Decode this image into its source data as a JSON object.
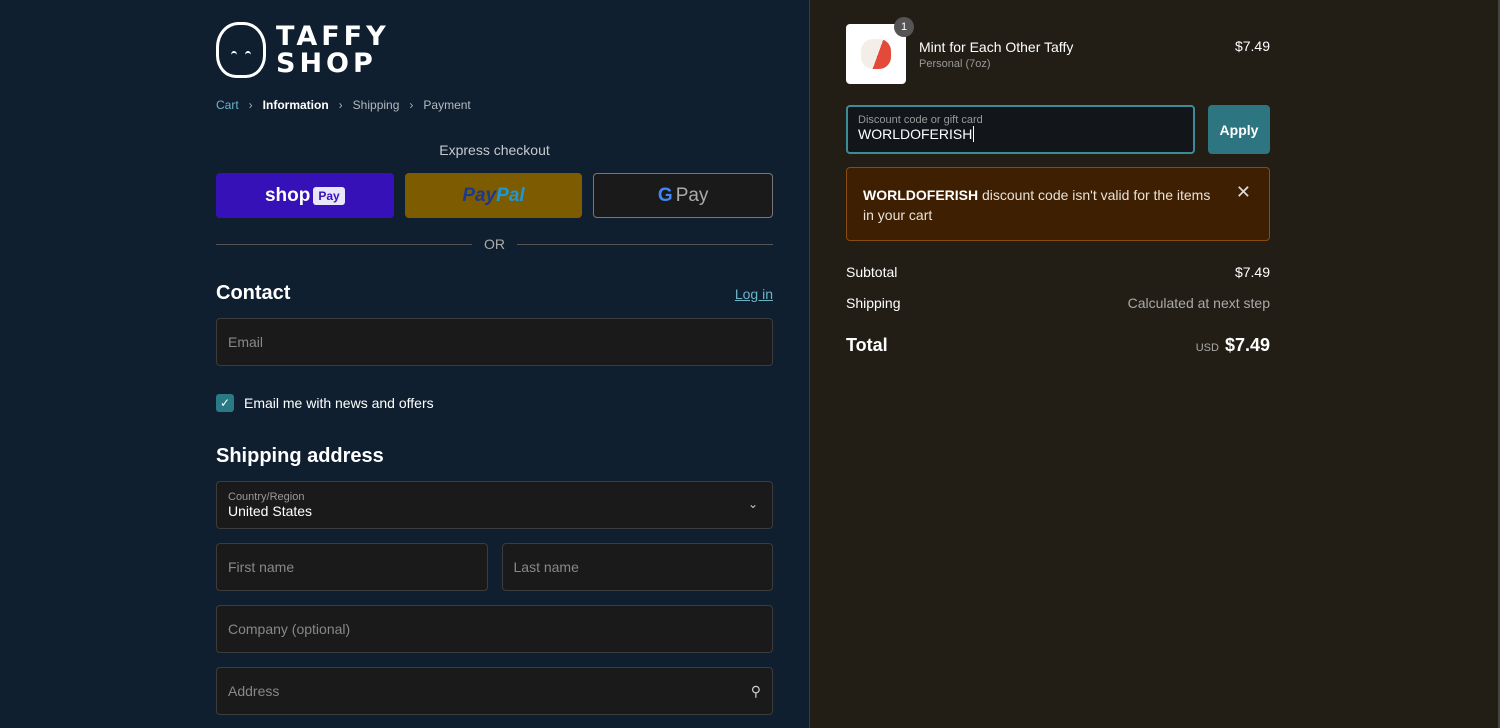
{
  "brand": {
    "name_line1": "TAFFY",
    "name_line2": "SHOP"
  },
  "breadcrumb": [
    "Cart",
    "Information",
    "Shipping",
    "Payment"
  ],
  "express": {
    "title": "Express checkout",
    "shop": "shop",
    "shop_pay": "Pay",
    "paypal_1": "Pay",
    "paypal_2": "Pal",
    "gpay_g": "G",
    "gpay": "Pay",
    "or": "OR"
  },
  "contact": {
    "title": "Contact",
    "login": "Log in",
    "email_placeholder": "Email",
    "newsletter": "Email me with news and offers",
    "newsletter_checked": true
  },
  "shipping": {
    "title": "Shipping address",
    "country_label": "Country/Region",
    "country": "United States",
    "first_name": "First name",
    "last_name": "Last name",
    "company": "Company (optional)",
    "address": "Address"
  },
  "cart": {
    "item": {
      "name": "Mint for Each Other Taffy",
      "variant": "Personal (7oz)",
      "price": "$7.49",
      "qty": "1"
    },
    "discount": {
      "label": "Discount code or gift card",
      "value": "WORLDOFERISH",
      "apply": "Apply"
    },
    "error": {
      "code": "WORLDOFERISH",
      "message": "discount code isn't valid for the items in your cart"
    },
    "subtotal_label": "Subtotal",
    "subtotal": "$7.49",
    "shipping_label": "Shipping",
    "shipping": "Calculated at next step",
    "total_label": "Total",
    "currency": "USD",
    "total": "$7.49"
  }
}
